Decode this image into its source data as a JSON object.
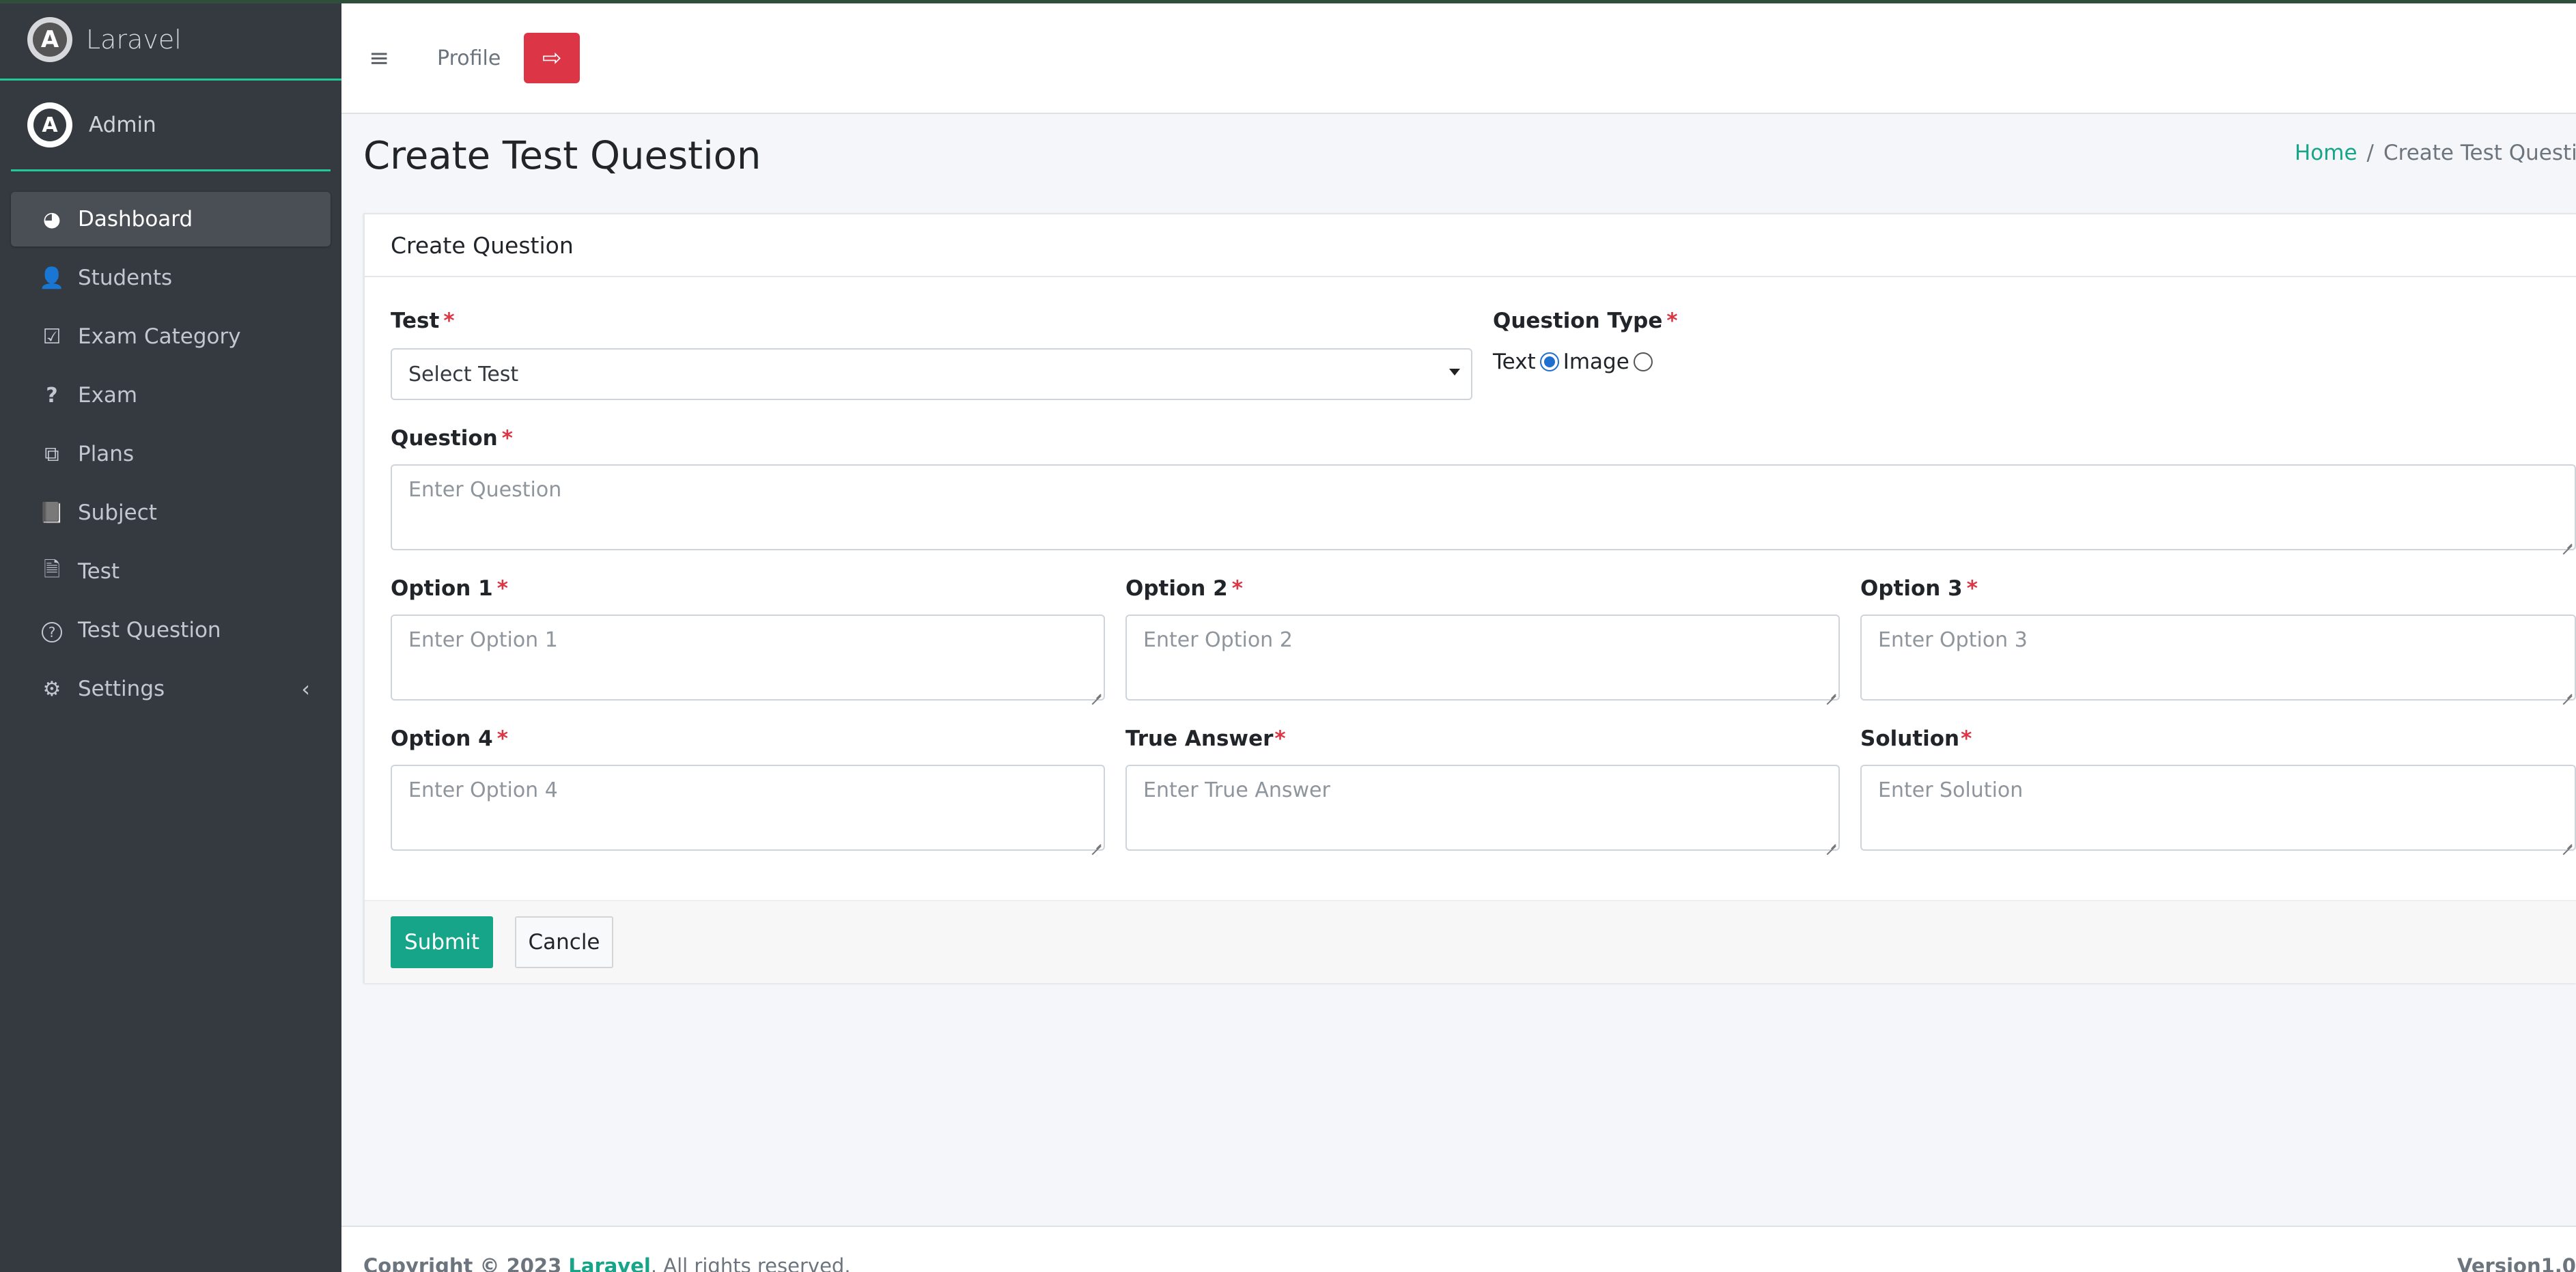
{
  "brand": {
    "name": "Laravel",
    "logo_letter": "A"
  },
  "user": {
    "name": "Admin",
    "avatar_letter": "A"
  },
  "sidebar": {
    "items": [
      {
        "label": "Dashboard",
        "icon": "dashboard-icon",
        "glyph": "◕",
        "active": true
      },
      {
        "label": "Students",
        "icon": "user-plus-icon",
        "glyph": "👤"
      },
      {
        "label": "Exam Category",
        "icon": "calendar-check-icon",
        "glyph": "☑"
      },
      {
        "label": "Exam",
        "icon": "question-icon",
        "glyph": "?"
      },
      {
        "label": "Plans",
        "icon": "plans-icon",
        "glyph": "⧉"
      },
      {
        "label": "Subject",
        "icon": "book-icon",
        "glyph": "📘"
      },
      {
        "label": "Test",
        "icon": "file-icon",
        "glyph": "🗎"
      },
      {
        "label": "Test Question",
        "icon": "question-circle-icon",
        "glyph": "?"
      },
      {
        "label": "Settings",
        "icon": "gear-icon",
        "glyph": "⚙",
        "arrow": "‹"
      }
    ]
  },
  "navbar": {
    "menu_glyph": "≡",
    "profile_label": "Profile",
    "logout_glyph": "⇨"
  },
  "header": {
    "page_title": "Create Test Question",
    "breadcrumb": {
      "home": "Home",
      "separator": "/",
      "current": "Create Test Question"
    }
  },
  "form": {
    "card_title": "Create Question",
    "required_mark": "*",
    "test": {
      "label": "Test",
      "selected": "Select Test"
    },
    "question_type": {
      "label": "Question Type",
      "options": [
        {
          "label": "Text",
          "checked": true
        },
        {
          "label": "Image",
          "checked": false
        }
      ]
    },
    "question": {
      "label": "Question",
      "placeholder": "Enter Question"
    },
    "option1": {
      "label": "Option 1",
      "placeholder": "Enter Option 1"
    },
    "option2": {
      "label": "Option 2",
      "placeholder": "Enter Option 2"
    },
    "option3": {
      "label": "Option 3",
      "placeholder": "Enter Option 3"
    },
    "option4": {
      "label": "Option 4",
      "placeholder": "Enter Option 4"
    },
    "true_answer": {
      "label": "True Answer",
      "placeholder": "Enter True Answer"
    },
    "solution": {
      "label": "Solution",
      "placeholder": "Enter Solution"
    },
    "submit_label": "Submit",
    "cancel_label": "Cancle"
  },
  "footer": {
    "copyright_prefix": "Copyright © 2023 ",
    "copyright_brand": "Laravel",
    "copyright_suffix": ". All rights reserved.",
    "version": "Version1.0"
  },
  "colors": {
    "accent": "#17a589",
    "danger": "#dc3545",
    "sidebar_bg": "#343a40"
  }
}
